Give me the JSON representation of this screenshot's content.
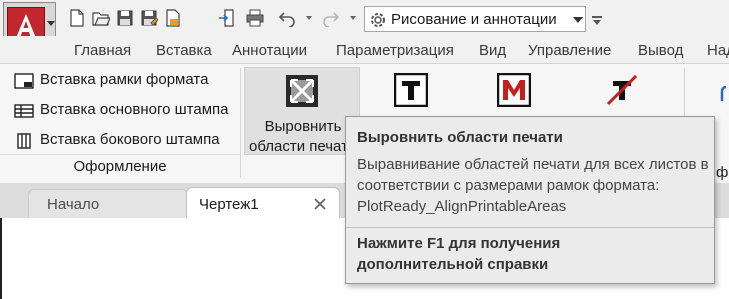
{
  "quick_access": {
    "workspace": "Рисование и аннотации",
    "icons": [
      "new-icon",
      "open-icon",
      "save-icon",
      "save-as-icon",
      "export-icon",
      "import-icon",
      "print-icon",
      "undo-icon",
      "redo-icon"
    ]
  },
  "tabs": [
    "Главная",
    "Вставка",
    "Аннотации",
    "Параметризация",
    "Вид",
    "Управление",
    "Вывод",
    "Над"
  ],
  "ribbon": {
    "items": [
      "Вставка рамки формата",
      "Вставка основного штампа",
      "Вставка бокового штампа"
    ],
    "panel_title": "Оформление",
    "big_button": {
      "line1": "Выровнить",
      "line2": "области печат"
    },
    "partial_text": "ф"
  },
  "doc_tabs": {
    "start": "Начало",
    "drawing": "Чертеж1"
  },
  "tooltip": {
    "title": "Выровнить области печати",
    "description": [
      "Выравнивание областей печати для всех листов в",
      "соответствии с размерами рамок формата:",
      "PlotReady_AlignPrintableAreas"
    ],
    "help": [
      "Нажмите F1 для получения",
      "дополнительной справки"
    ]
  },
  "colors": {
    "app_red": "#c1272d",
    "ribbon_bg": "#f6f6f6",
    "tooltip_bg": "#ebebeb",
    "tab_bar": "#dcdcdc"
  }
}
